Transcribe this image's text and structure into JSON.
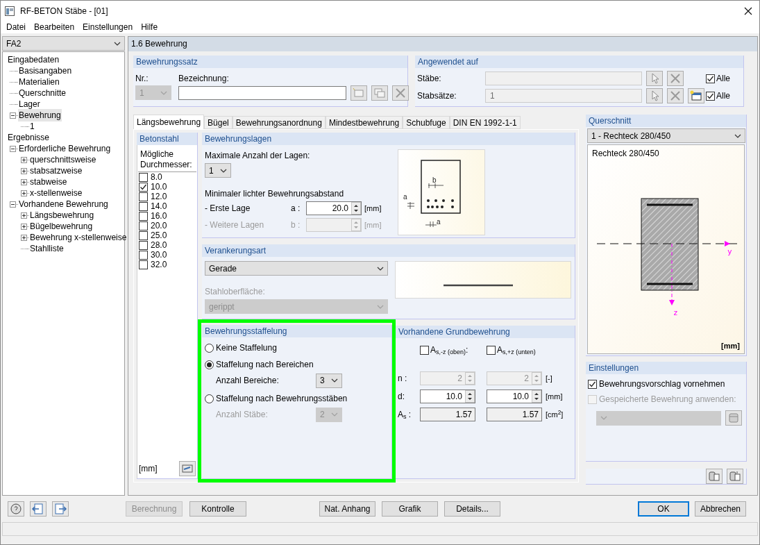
{
  "window": {
    "title": "RF-BETON Stäbe - [01]"
  },
  "menu": [
    "Datei",
    "Bearbeiten",
    "Einstellungen",
    "Hilfe"
  ],
  "navigator": {
    "case": "FA2",
    "tree": [
      {
        "label": "Eingabedaten",
        "selected": false,
        "children": [
          {
            "label": "Basisangaben",
            "selected": false
          },
          {
            "label": "Materialien",
            "selected": false
          },
          {
            "label": "Querschnitte",
            "selected": false
          },
          {
            "label": "Lager",
            "selected": false
          },
          {
            "label": "Bewehrung",
            "selected": true,
            "expanded": true,
            "children": [
              {
                "label": "1",
                "selected": false
              }
            ]
          }
        ]
      },
      {
        "label": "Ergebnisse",
        "selected": false,
        "children": [
          {
            "label": "Erforderliche Bewehrung",
            "selected": false,
            "expanded": true,
            "children": [
              {
                "label": "querschnittsweise",
                "selected": false,
                "expanded": false
              },
              {
                "label": "stabsatzweise",
                "selected": false,
                "expanded": false
              },
              {
                "label": "stabweise",
                "selected": false,
                "expanded": false
              },
              {
                "label": "x-stellenweise",
                "selected": false,
                "expanded": false
              }
            ]
          },
          {
            "label": "Vorhandene Bewehrung",
            "selected": false,
            "expanded": true,
            "children": [
              {
                "label": "Längsbewehrung",
                "selected": false,
                "expanded": false
              },
              {
                "label": "Bügelbewehrung",
                "selected": false,
                "expanded": false
              },
              {
                "label": "Bewehrung x-stellenweise",
                "selected": false,
                "expanded": false
              },
              {
                "label": "Stahlliste",
                "selected": false
              }
            ]
          }
        ]
      }
    ]
  },
  "panel_title": "1.6 Bewehrung",
  "reinforcement_set": {
    "title": "Bewehrungssatz",
    "nr_label": "Nr.:",
    "nr_value": "1",
    "name_label": "Bezeichnung:"
  },
  "applied_to": {
    "title": "Angewendet auf",
    "rows": [
      {
        "label": "Stäbe:",
        "all_label": "Alle",
        "all_checked": true,
        "new_button": false
      },
      {
        "label": "Stabsätze:",
        "value": "1",
        "all_label": "Alle",
        "all_checked": true,
        "new_button": true
      }
    ]
  },
  "tabs": [
    {
      "label": "Längsbewehrung",
      "selected": true
    },
    {
      "label": "Bügel",
      "selected": false
    },
    {
      "label": "Bewehrungsanordnung",
      "selected": false
    },
    {
      "label": "Mindestbewehrung",
      "selected": false
    },
    {
      "label": "Schubfuge",
      "selected": false
    },
    {
      "label": "DIN EN 1992-1-1",
      "selected": false
    }
  ],
  "rebar_steel": {
    "title": "Betonstahl",
    "label": "Mögliche Durchmesser:",
    "unit": "[mm]",
    "diameters": [
      {
        "value": "8.0",
        "checked": false
      },
      {
        "value": "10.0",
        "checked": true
      },
      {
        "value": "12.0",
        "checked": false
      },
      {
        "value": "14.0",
        "checked": false
      },
      {
        "value": "16.0",
        "checked": false
      },
      {
        "value": "20.0",
        "checked": false
      },
      {
        "value": "25.0",
        "checked": false
      },
      {
        "value": "28.0",
        "checked": false
      },
      {
        "value": "30.0",
        "checked": false
      },
      {
        "value": "32.0",
        "checked": false
      }
    ]
  },
  "layers": {
    "title": "Bewehrungslagen",
    "max_label": "Maximale Anzahl der Lagen:",
    "max_value": "1",
    "spacing_label": "Minimaler lichter Bewehrungsabstand",
    "rows": [
      {
        "label": "- Erste Lage",
        "symbol": "a :",
        "value": "20.0",
        "unit": "[mm]",
        "disabled": false
      },
      {
        "label": "- Weitere Lagen",
        "symbol": "b :",
        "unit": "[mm]",
        "disabled": true
      }
    ],
    "diagram_labels": [
      "b",
      "a",
      "a"
    ]
  },
  "anchorage": {
    "title": "Verankerungsart",
    "type": "Gerade",
    "surface_label": "Stahloberfläche:",
    "surface_value": "gerippt",
    "surface_disabled": true
  },
  "staggering": {
    "title": "Bewehrungsstaffelung",
    "highlighted": true,
    "options": [
      {
        "label": "Keine Staffelung",
        "selected": false
      },
      {
        "label": "Staffelung nach Bereichen",
        "selected": true,
        "count_label": "Anzahl Bereiche:",
        "count_value": "3"
      },
      {
        "label": "Staffelung nach Bewehrungsstäben",
        "selected": false,
        "count_label": "Anzahl Stäbe:",
        "count_value": "2"
      }
    ]
  },
  "basic_reinforcement": {
    "title": "Vorhandene Grundbewehrung",
    "columns": [
      {
        "label": "A$_{s,-z (oben)}$:",
        "checked": false
      },
      {
        "label": "A$_{s,+z (unten)}$",
        "checked": false
      }
    ],
    "rows": [
      {
        "label": "n :",
        "kind": "spin",
        "disabled": true,
        "values": [
          "2",
          "2"
        ],
        "unit": "[-]"
      },
      {
        "label": "d:",
        "kind": "spin",
        "disabled": false,
        "values": [
          "10.0",
          "10.0"
        ],
        "unit": "[mm]"
      },
      {
        "label": "A$_{s}$ :",
        "kind": "readonly",
        "values": [
          "1.57",
          "1.57"
        ],
        "unit": "[cm$^{2}$]"
      }
    ]
  },
  "cross_section": {
    "title": "Querschnitt",
    "selection": "1 - Rechteck 280/450",
    "name": "Rechteck 280/450",
    "unit": "[mm]",
    "axis_labels": [
      "y",
      "z"
    ]
  },
  "settings": {
    "title": "Einstellungen",
    "options": [
      {
        "label": "Bewehrungsvorschlag vornehmen",
        "checked": true,
        "disabled": false
      },
      {
        "label": "Gespeicherte Bewehrung anwenden:",
        "checked": false,
        "disabled": true
      }
    ]
  },
  "action_buttons": [
    {
      "label": "Berechnung",
      "disabled": true
    },
    {
      "label": "Kontrolle",
      "disabled": false
    }
  ],
  "info_buttons": [
    {
      "label": "Nat. Anhang",
      "disabled": false
    },
    {
      "label": "Grafik",
      "disabled": false
    },
    {
      "label": "Details...",
      "disabled": false
    }
  ],
  "dialog_buttons": [
    {
      "label": "OK",
      "default": true
    },
    {
      "label": "Abbrechen",
      "default": false
    }
  ]
}
